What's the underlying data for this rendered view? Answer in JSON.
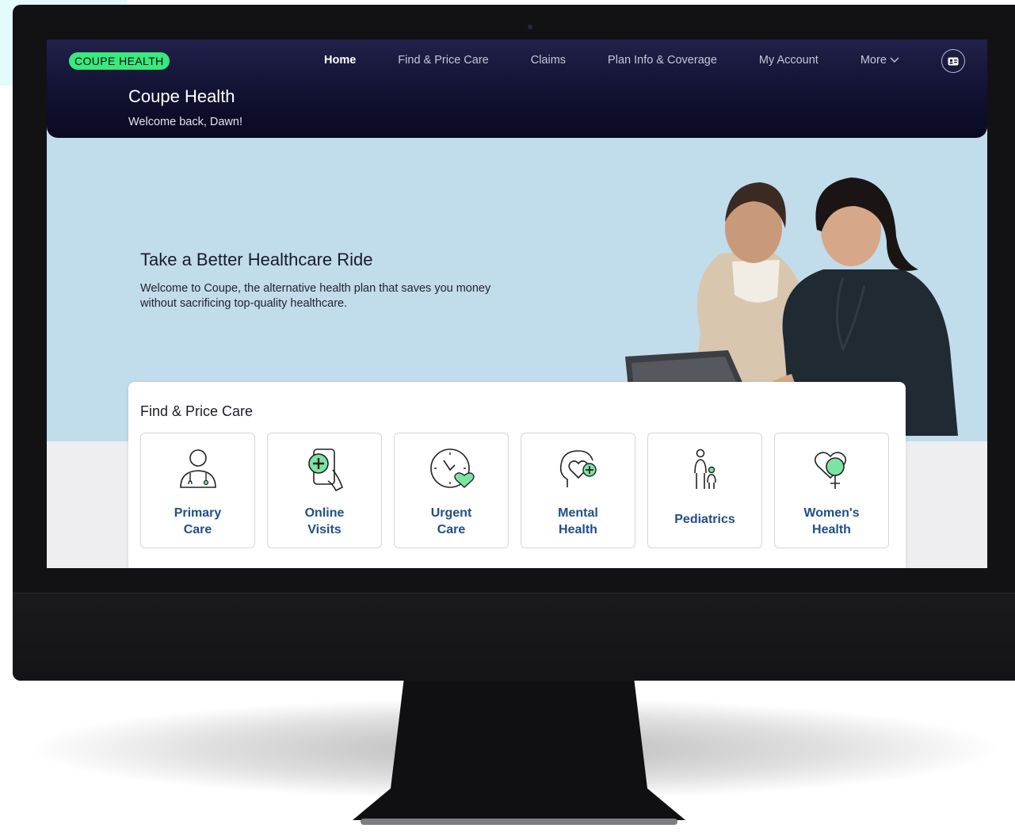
{
  "colors": {
    "brand_green": "#39e97a",
    "nav_dark": "#0f0f2e",
    "hero_blue": "#c1dcea",
    "link_blue": "#214e86"
  },
  "header": {
    "logo_text": "COUPE HEALTH",
    "title": "Coupe Health",
    "welcome": "Welcome back, Dawn!",
    "avatar_icon": "id-card-icon"
  },
  "nav": {
    "items": [
      {
        "label": "Home",
        "active": true
      },
      {
        "label": "Find & Price Care"
      },
      {
        "label": "Claims"
      },
      {
        "label": "Plan Info & Coverage"
      },
      {
        "label": "My Account"
      },
      {
        "label": "More",
        "icon": "chevron-down-icon"
      }
    ]
  },
  "hero": {
    "title": "Take a Better Healthcare Ride",
    "body": "Welcome to Coupe, the alternative health plan that saves you money without sacrificing top-quality healthcare."
  },
  "find_care": {
    "title": "Find & Price Care",
    "tiles": [
      {
        "line1": "Primary",
        "line2": "Care",
        "icon": "doctor-icon"
      },
      {
        "line1": "Online",
        "line2": "Visits",
        "icon": "phone-medical-icon"
      },
      {
        "line1": "Urgent",
        "line2": "Care",
        "icon": "clock-heart-icon"
      },
      {
        "line1": "Mental",
        "line2": "Health",
        "icon": "head-heart-icon"
      },
      {
        "line1": "Pediatrics",
        "line2": "",
        "icon": "parent-child-icon"
      },
      {
        "line1": "Women's",
        "line2": "Health",
        "icon": "female-heart-icon"
      }
    ]
  }
}
